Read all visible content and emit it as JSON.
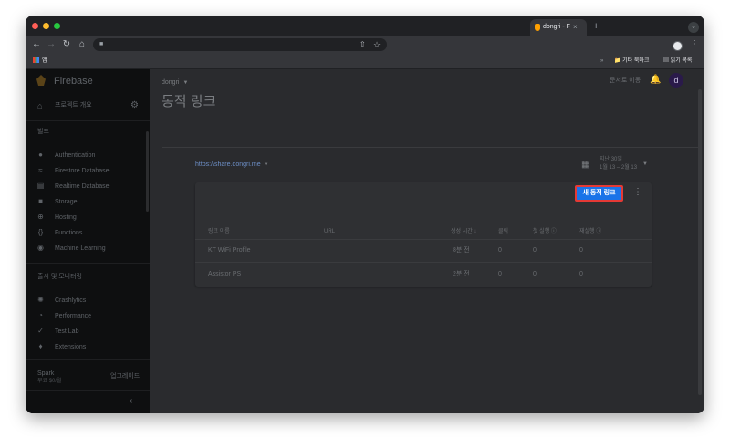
{
  "browser": {
    "tab_title": "dongri - F",
    "tab_close": "×",
    "new_tab": "+",
    "tab_menu": "⌄",
    "nav": {
      "back": "←",
      "forward": "→",
      "reload": "↻",
      "home": "⌂"
    },
    "address": "",
    "bookmarks": {
      "apps": "앱",
      "more": "»",
      "other": "기타 북마크",
      "reading_list": "읽기 목록"
    }
  },
  "sidebar": {
    "brand": "Firebase",
    "overview": "프로젝트 개요",
    "build_section": "빌드",
    "build_items": [
      {
        "label": "Authentication",
        "icon": "people-icon"
      },
      {
        "label": "Firestore Database",
        "icon": "wifi-icon"
      },
      {
        "label": "Realtime Database",
        "icon": "database-icon"
      },
      {
        "label": "Storage",
        "icon": "folder-icon"
      },
      {
        "label": "Hosting",
        "icon": "globe-icon"
      },
      {
        "label": "Functions",
        "icon": "braces-icon"
      },
      {
        "label": "Machine Learning",
        "icon": "robot-icon"
      }
    ],
    "release_section": "출시 및 모니터링",
    "release_items": [
      {
        "label": "Crashlytics",
        "icon": "crash-icon"
      },
      {
        "label": "Performance",
        "icon": "gauge-icon"
      },
      {
        "label": "Test Lab",
        "icon": "check-icon"
      },
      {
        "label": "Extensions",
        "icon": "puzzle-icon"
      }
    ],
    "plan_name": "Spark",
    "plan_desc": "무료 $0/월",
    "upgrade": "업그레이드",
    "collapse": "‹"
  },
  "header": {
    "project": "dongri",
    "docs": "문서로 이동",
    "avatar_letter": "d"
  },
  "main": {
    "title": "동적 링크",
    "domain": "https://share.dongri.me",
    "date_line1": "지난 30일",
    "date_line2": "1월 13 – 2월 13",
    "new_link_button": "새 동적 링크",
    "columns": [
      "링크 이름",
      "URL",
      "생성 시간 ↓",
      "클릭",
      "첫 실행 ⓘ",
      "재실행 ⓘ"
    ],
    "rows": [
      {
        "name": "KT WiFi Profile",
        "url": "",
        "created": "8분 전",
        "clicks": "0",
        "first_open": "0",
        "reopen": "0"
      },
      {
        "name": "Assistor PS",
        "url": "",
        "created": "2분 전",
        "clicks": "0",
        "first_open": "0",
        "reopen": "0"
      }
    ]
  },
  "colors": {
    "accent_button": "#1a73e8",
    "highlight_border": "#e53935",
    "link": "#6d8fc7"
  }
}
